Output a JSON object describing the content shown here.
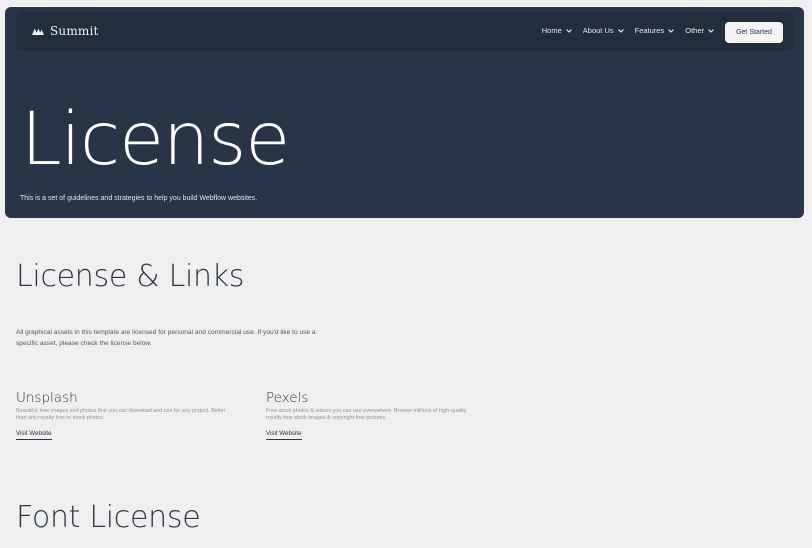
{
  "brand": {
    "name": "Summit",
    "logo_icon": "summit-logo-icon"
  },
  "nav": {
    "items": [
      {
        "label": "Home"
      },
      {
        "label": "About Us"
      },
      {
        "label": "Features"
      },
      {
        "label": "Other"
      }
    ],
    "cta_label": "Get Started",
    "dropdown_icon": "chevron-down-icon"
  },
  "hero": {
    "title": "License",
    "subtitle": "This is a set of guidelines and strategies to help you build Webflow websites."
  },
  "links_section": {
    "title": "License & Links",
    "intro": "All graphical assets in this template are licensed for personal and commercial use. If you'd like to use a specific asset, please check the license below.",
    "resources": [
      {
        "title": "Unsplash",
        "description": "Beautiful, free images and photos that you can download and use for any project. Better than any royalty free or stock photos.",
        "link_label": "Visit Website"
      },
      {
        "title": "Pexels",
        "description": "Free stock photos & videos you can use everywhere. Browse millions of high-quality royalty free stock images & copyright free pictures.",
        "link_label": "Visit Website"
      }
    ]
  },
  "font_section": {
    "title": "Font License"
  },
  "colors": {
    "hero_bg": "#283447",
    "navbar_bg": "#222d3d",
    "page_bg": "#efefef",
    "text_dark": "#2a3546",
    "button_bg": "#f4f4f4"
  }
}
